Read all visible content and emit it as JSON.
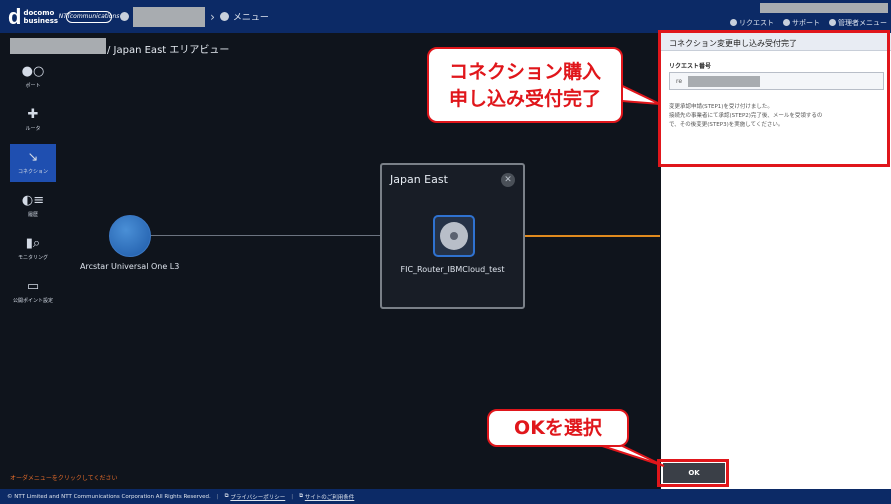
{
  "header": {
    "logo_mark": "d",
    "logo_text_1": "docomo",
    "logo_text_2": "business",
    "ntt_logo": "NTTcommunications",
    "breadcrumb_menu": "メニュー",
    "links": [
      "リクエスト",
      "サポート",
      "管理者メニュー"
    ]
  },
  "page": {
    "title": "/ Japan East エリアビュー"
  },
  "sidebar": {
    "items": [
      {
        "label": "ポート",
        "icon": "port-icon"
      },
      {
        "label": "ルータ",
        "icon": "router-icon"
      },
      {
        "label": "コネクション",
        "icon": "connection-icon",
        "active": true
      },
      {
        "label": "履歴",
        "icon": "history-icon"
      },
      {
        "label": "モニタリング",
        "icon": "monitoring-icon"
      },
      {
        "label": "公開ポイント設定",
        "icon": "monitor-icon"
      }
    ]
  },
  "canvas": {
    "globe_label": "Arcstar Universal One L3",
    "region_title": "Japan East",
    "router_label": "FIC_Router_IBMCloud_test",
    "hint": "オーダメニューをクリックしてください"
  },
  "panel": {
    "title": "コネクション変更申し込み受付完了",
    "request_label": "リクエスト番号",
    "request_prefix": "re",
    "message_lines": [
      "変更承認申請(STEP1)を受け付けました。",
      "接続先の事業者にて承認(STEP2)完了後、メールを受領するの",
      "で、その後変更(STEP3)を実施してください。"
    ],
    "ok_label": "OK"
  },
  "callouts": {
    "top_line1": "コネクション購入",
    "top_line2": "申し込み受付完了",
    "bottom": "OKを選択"
  },
  "footer": {
    "copyright": "© NTT Limited and NTT Communications Corporation All Rights Reserved.",
    "privacy": "プライバシーポリシー",
    "terms": "サイトのご利用条件"
  },
  "colors": {
    "header_bg": "#0c2a66",
    "accent_red": "#e0161b",
    "connection_orange": "#e08a1e",
    "active_blue": "#1f4fb0"
  }
}
